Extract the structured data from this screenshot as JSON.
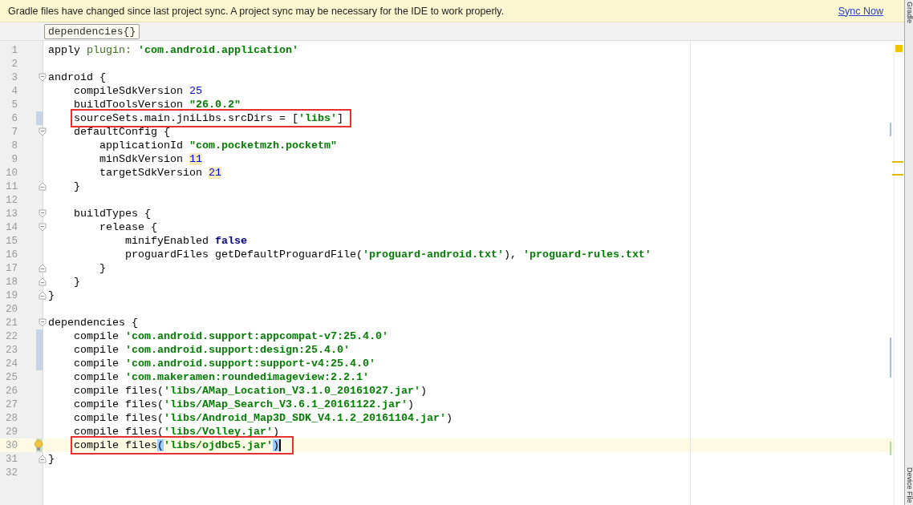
{
  "banner": {
    "message": "Gradle files have changed since last project sync. A project sync may be necessary for the IDE to work properly.",
    "action": "Sync Now"
  },
  "breadcrumb": "dependencies{}",
  "side_tabs": [
    "Gradle",
    "Device File"
  ],
  "lines": [
    {
      "number": "1",
      "tokens": [
        {
          "kind": "plain",
          "text": "apply "
        },
        {
          "kind": "label",
          "text": "plugin: "
        },
        {
          "kind": "string",
          "text": "'com.android.application'"
        }
      ]
    },
    {
      "number": "2"
    },
    {
      "number": "3",
      "fold_open": true,
      "tokens": [
        {
          "kind": "plain",
          "text": "android {"
        }
      ]
    },
    {
      "number": "4",
      "tokens": [
        {
          "kind": "plain",
          "text": "compileSdkVersion "
        },
        {
          "kind": "number",
          "text": "25"
        }
      ]
    },
    {
      "number": "5",
      "tokens": [
        {
          "kind": "plain",
          "text": "buildToolsVersion "
        },
        {
          "kind": "string",
          "text": "\"26.0.2\""
        }
      ]
    },
    {
      "number": "6",
      "modified": true,
      "boxed": true,
      "tokens": [
        {
          "kind": "plain",
          "text": "sourceSets.main.jniLibs.srcDirs = ["
        },
        {
          "kind": "string",
          "text": "'libs'"
        },
        {
          "kind": "plain",
          "text": "]"
        }
      ]
    },
    {
      "number": "7",
      "fold_open": true,
      "tokens": [
        {
          "kind": "plain",
          "text": "defaultConfig {"
        }
      ]
    },
    {
      "number": "8",
      "tokens": [
        {
          "kind": "plain",
          "text": "applicationId "
        },
        {
          "kind": "string",
          "text": "\"com.pocketmzh.pocketm\""
        }
      ]
    },
    {
      "number": "9",
      "tokens": [
        {
          "kind": "plain",
          "text": "minSdkVersion "
        },
        {
          "kind": "number",
          "text": "11",
          "warning": true
        }
      ]
    },
    {
      "number": "10",
      "tokens": [
        {
          "kind": "plain",
          "text": "targetSdkVersion "
        },
        {
          "kind": "number",
          "text": "21",
          "warning": true
        }
      ]
    },
    {
      "number": "11",
      "fold_close": true,
      "tokens": [
        {
          "kind": "plain",
          "text": "}"
        }
      ]
    },
    {
      "number": "12"
    },
    {
      "number": "13",
      "fold_open": true,
      "tokens": [
        {
          "kind": "plain",
          "text": "buildTypes {"
        }
      ]
    },
    {
      "number": "14",
      "fold_open": true,
      "tokens": [
        {
          "kind": "plain",
          "text": "release {"
        }
      ]
    },
    {
      "number": "15",
      "tokens": [
        {
          "kind": "plain",
          "text": "minifyEnabled "
        },
        {
          "kind": "keyword",
          "text": "false"
        }
      ]
    },
    {
      "number": "16",
      "tokens": [
        {
          "kind": "plain",
          "text": "proguardFiles getDefaultProguardFile("
        },
        {
          "kind": "string",
          "text": "'proguard-android.txt'"
        },
        {
          "kind": "plain",
          "text": "), "
        },
        {
          "kind": "string",
          "text": "'proguard-rules.txt'"
        }
      ]
    },
    {
      "number": "17",
      "fold_close": true,
      "tokens": [
        {
          "kind": "plain",
          "text": "}"
        }
      ]
    },
    {
      "number": "18",
      "fold_close": true,
      "tokens": [
        {
          "kind": "plain",
          "text": "}"
        }
      ]
    },
    {
      "number": "19",
      "fold_close": true,
      "tokens": [
        {
          "kind": "plain",
          "text": "}"
        }
      ]
    },
    {
      "number": "20"
    },
    {
      "number": "21",
      "fold_open": true,
      "tokens": [
        {
          "kind": "plain",
          "text": "dependencies {"
        }
      ]
    },
    {
      "number": "22",
      "modified": true,
      "tokens": [
        {
          "kind": "plain",
          "text": "compile "
        },
        {
          "kind": "string",
          "text": "'com.android.support:appcompat-v7:25.4.0'"
        }
      ]
    },
    {
      "number": "23",
      "modified": true,
      "tokens": [
        {
          "kind": "plain",
          "text": "compile "
        },
        {
          "kind": "string",
          "text": "'com.android.support:design:25.4.0'"
        }
      ]
    },
    {
      "number": "24",
      "modified": true,
      "tokens": [
        {
          "kind": "plain",
          "text": "compile "
        },
        {
          "kind": "string",
          "text": "'com.android.support:support-v4:25.4.0'"
        }
      ]
    },
    {
      "number": "25",
      "tokens": [
        {
          "kind": "plain",
          "text": "compile "
        },
        {
          "kind": "string",
          "text": "'com.makeramen:roundedimageview:2.2.1'"
        }
      ]
    },
    {
      "number": "26",
      "tokens": [
        {
          "kind": "plain",
          "text": "compile files("
        },
        {
          "kind": "string",
          "text": "'libs/AMap_Location_V3.1.0_20161027.jar'"
        },
        {
          "kind": "plain",
          "text": ")"
        }
      ]
    },
    {
      "number": "27",
      "tokens": [
        {
          "kind": "plain",
          "text": "compile files("
        },
        {
          "kind": "string",
          "text": "'libs/AMap_Search_V3.6.1_20161122.jar'"
        },
        {
          "kind": "plain",
          "text": ")"
        }
      ]
    },
    {
      "number": "28",
      "tokens": [
        {
          "kind": "plain",
          "text": "compile files("
        },
        {
          "kind": "string",
          "text": "'libs/Android_Map3D_SDK_V4.1.2_20161104.jar'"
        },
        {
          "kind": "plain",
          "text": ")"
        }
      ]
    },
    {
      "number": "29",
      "tokens": [
        {
          "kind": "plain",
          "text": "compile files("
        },
        {
          "kind": "string",
          "text": "'libs/Volley.jar'"
        },
        {
          "kind": "plain",
          "text": ")"
        }
      ]
    },
    {
      "number": "30",
      "added": true,
      "boxed": true,
      "current": true,
      "bulb": true,
      "caret": true,
      "tokens": [
        {
          "kind": "plain",
          "text": "compile files"
        },
        {
          "kind": "paren",
          "text": "(",
          "matched": true
        },
        {
          "kind": "string",
          "text": "'libs/ojdbc5.jar'"
        },
        {
          "kind": "paren",
          "text": ")",
          "matched": true
        }
      ]
    },
    {
      "number": "31",
      "fold_close": true,
      "tokens": [
        {
          "kind": "plain",
          "text": "}"
        }
      ]
    },
    {
      "number": "32"
    }
  ]
}
